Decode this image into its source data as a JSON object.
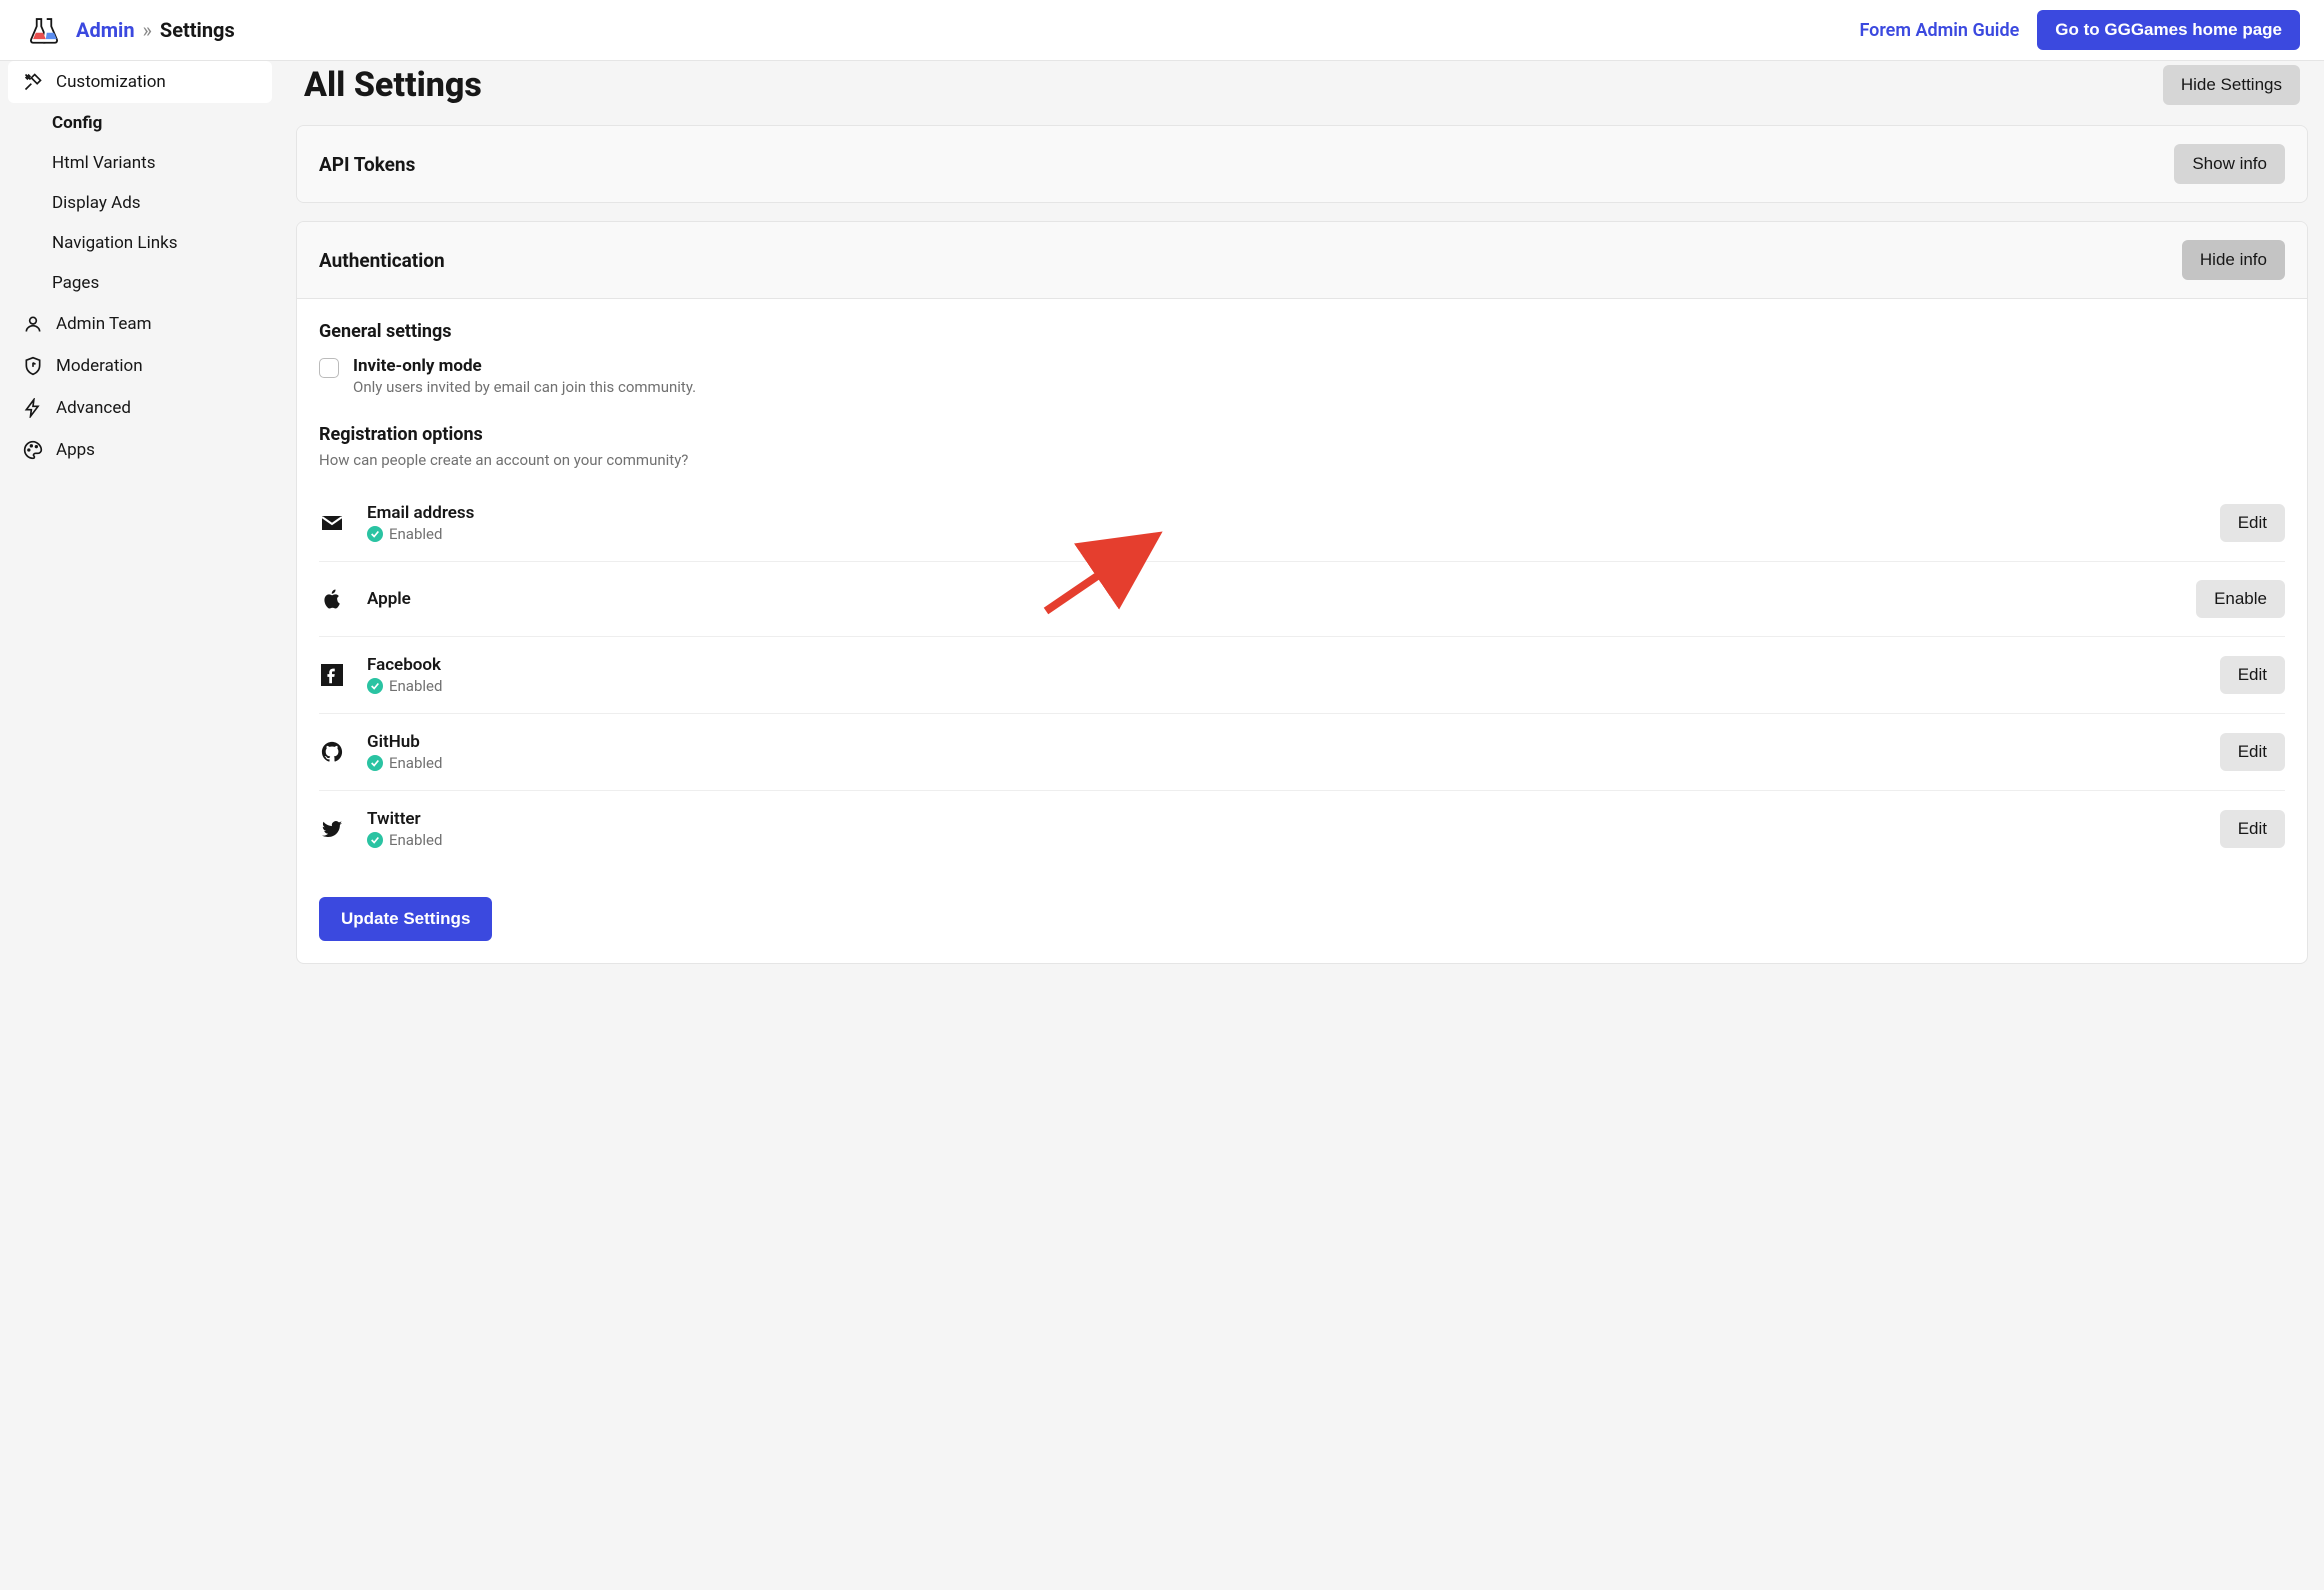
{
  "breadcrumb": {
    "admin": "Admin",
    "sep": "»",
    "current": "Settings"
  },
  "topbar": {
    "guide_link": "Forem Admin Guide",
    "home_button": "Go to GGGames home page"
  },
  "sidebar": {
    "customization": "Customization",
    "sub": {
      "config": "Config",
      "html_variants": "Html Variants",
      "display_ads": "Display Ads",
      "navigation_links": "Navigation Links",
      "pages": "Pages"
    },
    "admin_team": "Admin Team",
    "moderation": "Moderation",
    "advanced": "Advanced",
    "apps": "Apps"
  },
  "page": {
    "title": "All Settings",
    "hide_settings": "Hide Settings"
  },
  "api_tokens": {
    "title": "API Tokens",
    "button": "Show info"
  },
  "auth": {
    "title": "Authentication",
    "button": "Hide info",
    "general_title": "General settings",
    "invite_label": "Invite-only mode",
    "invite_help": "Only users invited by email can join this community.",
    "reg_title": "Registration options",
    "reg_help": "How can people create an account on your community?",
    "enabled": "Enabled",
    "providers": {
      "email": {
        "name": "Email address",
        "button": "Edit"
      },
      "apple": {
        "name": "Apple",
        "button": "Enable"
      },
      "facebook": {
        "name": "Facebook",
        "button": "Edit"
      },
      "github": {
        "name": "GitHub",
        "button": "Edit"
      },
      "twitter": {
        "name": "Twitter",
        "button": "Edit"
      }
    },
    "update": "Update Settings"
  }
}
